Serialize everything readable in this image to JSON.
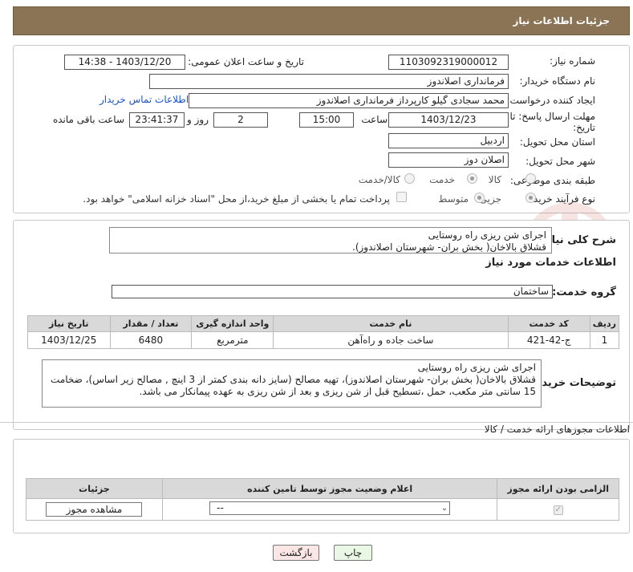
{
  "header": {
    "title": "جزئیات اطلاعات نیاز"
  },
  "form": {
    "need_number_label": "شماره نیاز:",
    "need_number": "1103092319000012",
    "announce_label": "تاریخ و ساعت اعلان عمومی:",
    "announce_value": "1403/12/20 - 14:38",
    "buyer_label": "نام دستگاه خریدار:",
    "buyer_value": "فرمانداری اصلاندوز",
    "creator_label": "ایجاد کننده درخواست:",
    "creator_value": "محمد سجادی گیلو کارپرداز فرمانداری اصلاندوز",
    "contact_link": "اطلاعات تماس خریدار",
    "deadline_label_1": "مهلت ارسال پاسخ: تا",
    "deadline_label_2": "تاریخ:",
    "deadline_date": "1403/12/23",
    "time_label": "ساعت",
    "deadline_time": "15:00",
    "days_value": "2",
    "days_label": "روز و",
    "remaining_time": "23:41:37",
    "remaining_label": "ساعت باقی مانده",
    "province_label": "استان محل تحویل:",
    "province_value": "اردبیل",
    "city_label": "شهر محل تحویل:",
    "city_value": "اصلان دوز",
    "category_label": "طبقه بندی موضوعی:",
    "category_options": [
      "کالا",
      "خدمت",
      "کالا/خدمت"
    ],
    "category_selected": "خدمت",
    "process_label": "نوع فرآیند خرید :",
    "process_options": [
      "جزیی",
      "متوسط"
    ],
    "process_selected": "جزیی",
    "payment_note": "پرداخت تمام یا بخشی از مبلغ خرید،از محل \"اسناد خزانه اسلامی\" خواهد بود."
  },
  "summary": {
    "label": "شرح کلی نیاز:",
    "line1": "اجرای شن ریزی راه روستایی",
    "line2": "قشلاق بالاخان( بخش بران- شهرستان اصلاندوز)."
  },
  "services": {
    "section_title": "اطلاعات خدمات مورد نیاز",
    "group_label": "گروه خدمت:",
    "group_value": "ساختمان",
    "columns": [
      "ردیف",
      "کد خدمت",
      "نام خدمت",
      "واحد اندازه گیری",
      "تعداد / مقدار",
      "تاریخ نیاز"
    ],
    "rows": [
      [
        "1",
        "ج-42-421",
        "ساخت جاده و راه‌آهن",
        "مترمربع",
        "6480",
        "1403/12/25"
      ]
    ]
  },
  "buyer_notes": {
    "label": "توضیحات خریدار:",
    "line1": "اجرای شن ریزی راه روستایی",
    "line2": "قشلاق بالاخان( بخش بران- شهرستان اصلاندوز)، تهیه مصالح (سایز دانه بندی کمتر از 3 اینچ , مصالح زیر اساس)، ضخامت",
    "line3": "15 سانتی متر مکعب، حمل ،تسطیح قبل از شن ریزی و بعد از شن ریزی  به عهده پیمانکار می باشد."
  },
  "permits": {
    "title": "اطلاعات مجوزهای ارائه خدمت / کالا",
    "columns": [
      "الزامی بودن ارائه مجوز",
      "اعلام وضعیت مجوز توسط تامین کننده",
      "جزئیات"
    ],
    "select_value": "--",
    "view_button": "مشاهده مجوز"
  },
  "buttons": {
    "print": "چاپ",
    "back": "بازگشت"
  },
  "watermark_text": "AriaTender.neT"
}
